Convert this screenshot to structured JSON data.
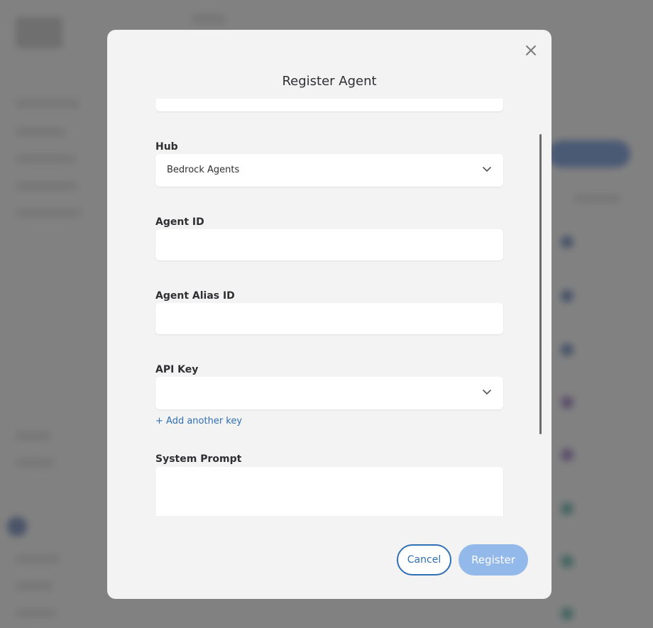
{
  "modal": {
    "title": "Register Agent",
    "close_icon": "close-icon",
    "fields": {
      "hub": {
        "label": "Hub",
        "value": "Bedrock Agents"
      },
      "agent_id": {
        "label": "Agent ID",
        "value": ""
      },
      "agent_alias_id": {
        "label": "Agent Alias ID",
        "value": ""
      },
      "api_key": {
        "label": "API Key",
        "value": ""
      },
      "system_prompt": {
        "label": "System Prompt",
        "value": ""
      }
    },
    "add_key_link": "+ Add another key",
    "buttons": {
      "cancel": "Cancel",
      "register": "Register"
    }
  },
  "colors": {
    "primary": "#2f6fb4",
    "register_disabled": "#93b9ea",
    "modal_bg": "#f3f3f3",
    "overlay": "#505050"
  }
}
